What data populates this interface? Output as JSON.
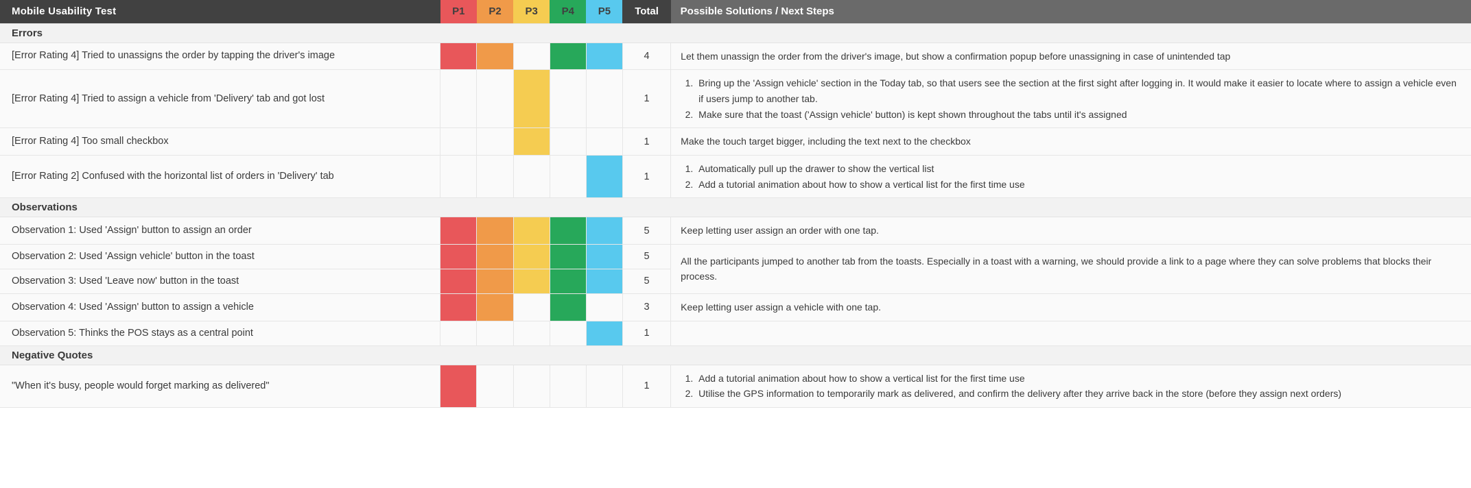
{
  "header": {
    "title": "Mobile Usability Test",
    "participants": [
      {
        "label": "P1",
        "color": "#e8575a"
      },
      {
        "label": "P2",
        "color": "#f09a49"
      },
      {
        "label": "P3",
        "color": "#f5cc51"
      },
      {
        "label": "P4",
        "color": "#27a85a"
      },
      {
        "label": "P5",
        "color": "#58c9ee"
      }
    ],
    "total_label": "Total",
    "solutions_label": "Possible Solutions / Next Steps"
  },
  "sections": {
    "errors": {
      "label": "Errors"
    },
    "observations": {
      "label": "Observations"
    },
    "negative_quotes": {
      "label": "Negative Quotes"
    }
  },
  "rows": {
    "error_1": {
      "item": "[Error Rating 4] Tried to unassigns the order by tapping the driver's image",
      "total": "4",
      "solution": "Let them unassign the order from the driver's image, but show a confirmation popup before unassigning in case of unintended tap"
    },
    "error_2": {
      "item": "[Error Rating 4] Tried to assign a vehicle from 'Delivery' tab and got lost",
      "total": "1",
      "solution_1": "Bring up the 'Assign vehicle' section in the Today tab, so that users see the section at the first sight after logging in. It would make it easier to locate where to assign a vehicle even if users jump to another tab.",
      "solution_2": "Make sure that the toast ('Assign vehicle' button) is kept shown throughout the tabs until it's assigned"
    },
    "error_3": {
      "item": "[Error Rating 4] Too small checkbox",
      "total": "1",
      "solution": "Make the touch target bigger, including the text next to the checkbox"
    },
    "error_4": {
      "item": "[Error Rating 2] Confused with the horizontal list of orders in 'Delivery' tab",
      "total": "1",
      "solution_1": "Automatically pull up the drawer to show the vertical list",
      "solution_2": "Add a tutorial animation about how to show a vertical list for the first time use"
    },
    "obs_1": {
      "item": "Observation 1: Used 'Assign' button to assign an order",
      "total": "5",
      "solution": "Keep letting user assign an order with one tap."
    },
    "obs_2": {
      "item": "Observation 2: Used 'Assign vehicle' button in the toast",
      "total": "5",
      "solution": "All the participants jumped to another tab from the toasts. Especially in a toast with a warning, we should provide a link to a page where they can solve problems that blocks their process."
    },
    "obs_3": {
      "item": "Observation 3: Used 'Leave now' button in the toast",
      "total": "5"
    },
    "obs_4": {
      "item": "Observation 4: Used 'Assign' button to assign a vehicle",
      "total": "3",
      "solution": "Keep letting user assign a vehicle with one tap."
    },
    "obs_5": {
      "item": "Observation 5: Thinks the POS stays as a central point",
      "total": "1",
      "solution": ""
    },
    "quote_1": {
      "item": "\"When it's busy, people would forget marking as delivered\"",
      "total": "1",
      "solution_1": "Add a tutorial animation about how to show a vertical list for the first time use",
      "solution_2": "Utilise the GPS information to temporarily mark as delivered, and confirm the delivery after they arrive back in the store (before they assign next orders)"
    }
  }
}
